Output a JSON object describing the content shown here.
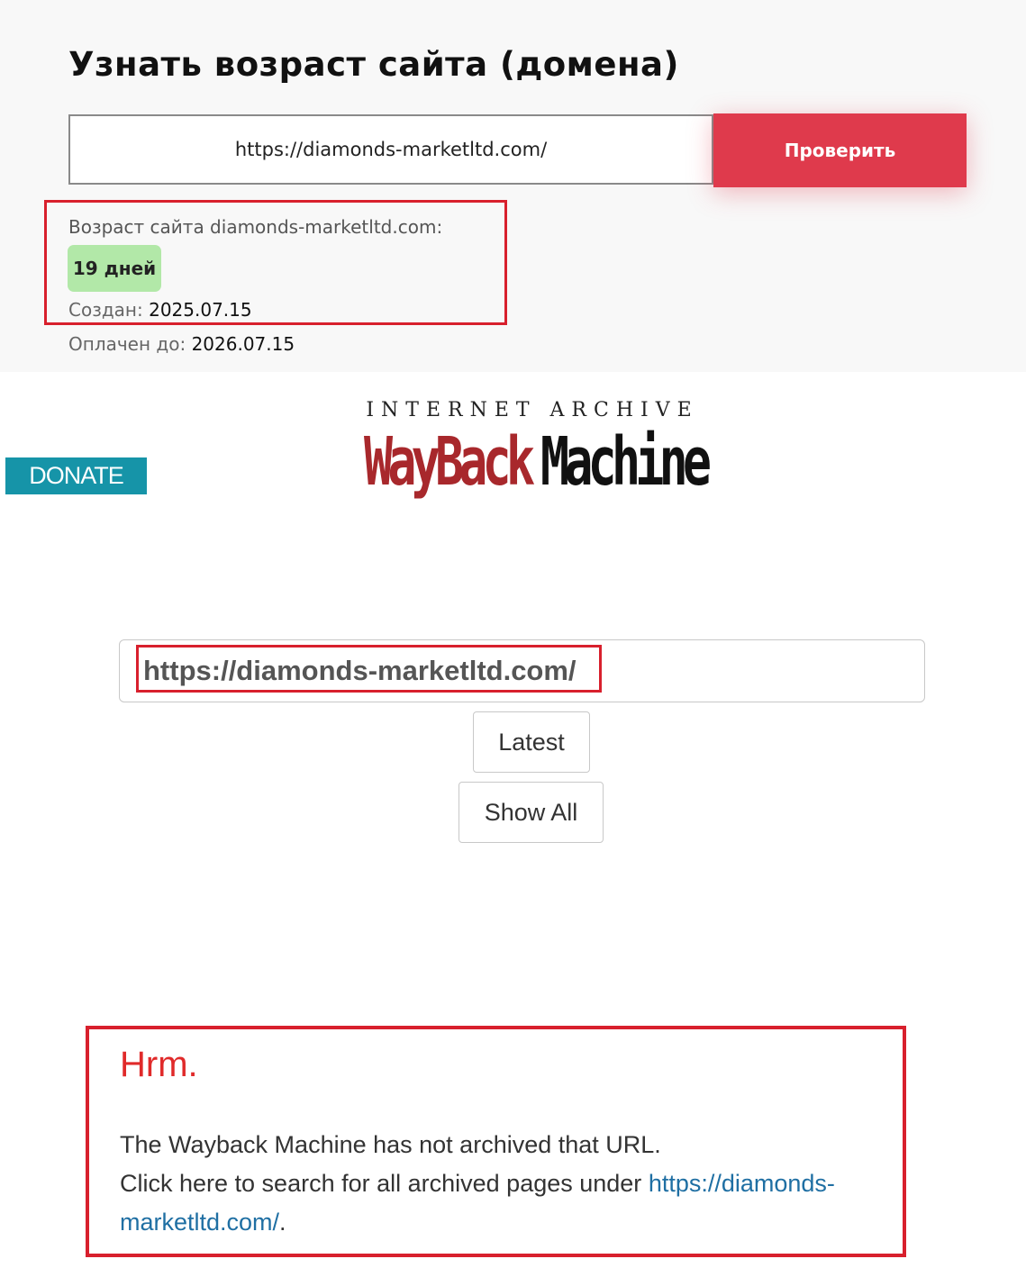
{
  "age_checker": {
    "title": "Узнать возраст сайта (домена)",
    "input_value": "https://diamonds-marketltd.com/",
    "check_button_label": "Проверить",
    "age_label": "Возраст сайта diamonds-marketltd.com:",
    "age_badge": "19 дней",
    "created_label": "Создан:",
    "created_value": "2025.07.15",
    "paid_label": "Оплачен до:",
    "paid_value": "2026.07.15"
  },
  "wayback": {
    "donate_label": "DONATE",
    "logo": {
      "top_text": "INTERNET ARCHIVE",
      "word_wayback": "WayBack",
      "word_machine": "Machine"
    },
    "url_input_value": "https://diamonds-marketltd.com/",
    "latest_label": "Latest",
    "show_all_label": "Show All",
    "result": {
      "heading": "Hrm.",
      "line1": "The Wayback Machine has not archived that URL.",
      "line2_prefix": "Click here to search for all archived pages under ",
      "link_part1": "https://diamonds-",
      "link_part2": "marketltd.com/",
      "line3_suffix": "."
    }
  },
  "colors": {
    "accent_red": "#df3a4c",
    "badge_green": "#b2e8a8",
    "donate_teal": "#1694a8",
    "highlight_red": "#d8202d",
    "link_blue": "#1f6fa3"
  }
}
